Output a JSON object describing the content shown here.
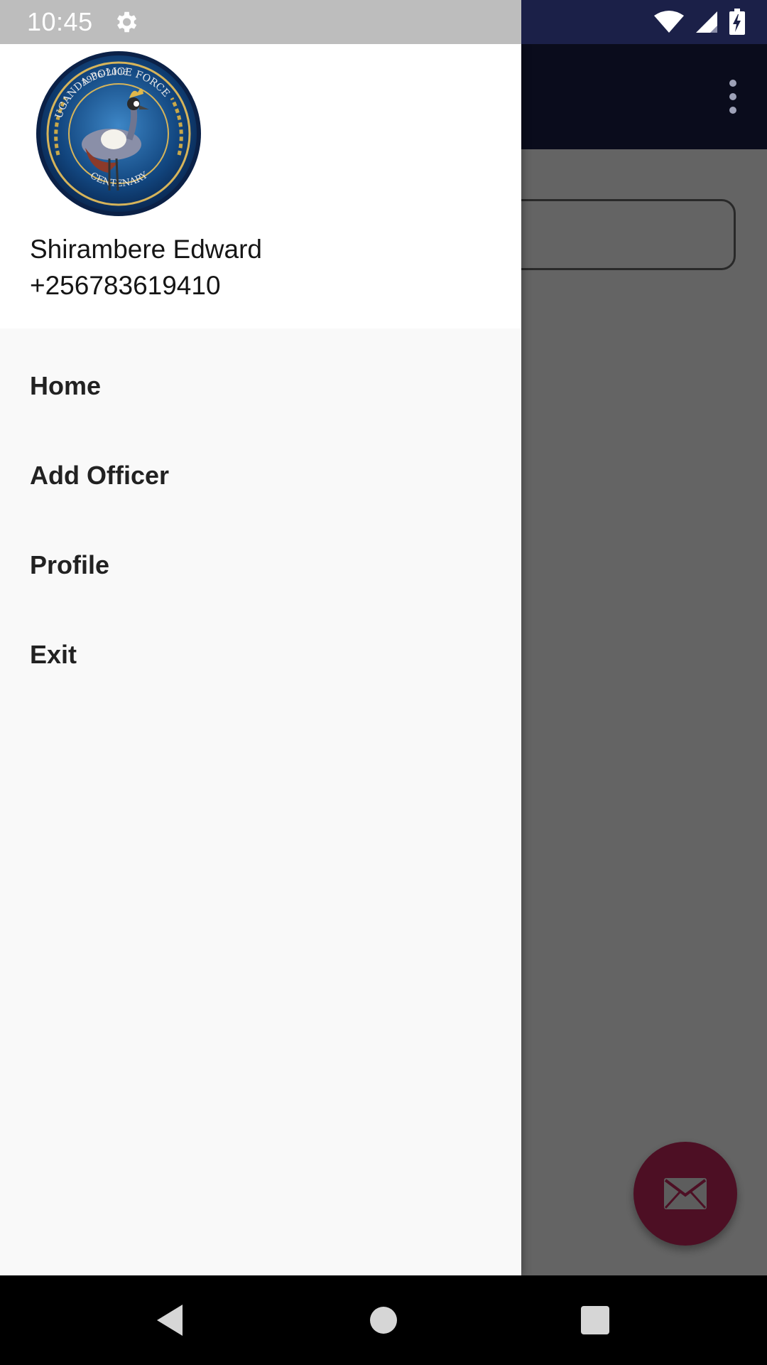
{
  "status_bar": {
    "time": "10:45",
    "icons": [
      "settings-icon",
      "wifi-icon",
      "cell-signal-icon",
      "battery-charging-icon"
    ]
  },
  "drawer": {
    "header": {
      "logo": {
        "icon": "uganda-police-force-emblem",
        "text_top": "UGANDA POLICE FORCE",
        "text_years": "1906-2006",
        "text_bottom": "CENTENARY"
      },
      "user_name": "Shirambere Edward",
      "user_phone": "+256783619410"
    },
    "menu": {
      "items": [
        {
          "label": "Home"
        },
        {
          "label": "Add Officer"
        },
        {
          "label": "Profile"
        },
        {
          "label": "Exit"
        }
      ]
    }
  },
  "app_bar": {
    "overflow_icon": "more-vert-icon"
  },
  "fab": {
    "icon": "mail-icon"
  },
  "nav_bar": {
    "icons": [
      "back-icon",
      "home-icon",
      "recent-apps-icon"
    ]
  },
  "colors": {
    "primary": "#1b2048",
    "accent": "#c0265a",
    "drawer_background": "#f9f9f9",
    "header_background": "#ffffff"
  }
}
